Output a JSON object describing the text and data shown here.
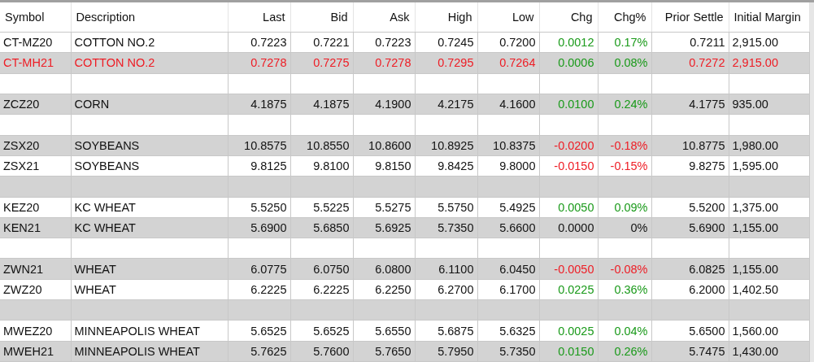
{
  "table": {
    "columns": [
      "Symbol",
      "Description",
      "Last",
      "Bid",
      "Ask",
      "High",
      "Low",
      "Chg",
      "Chg%",
      "Prior Settle",
      "Initial Margin"
    ],
    "rows": [
      {
        "kind": "quote",
        "alert": false,
        "color": "#1a9a1a",
        "cells": [
          "CT-MZ20",
          "COTTON NO.2",
          "0.7223",
          "0.7221",
          "0.7223",
          "0.7245",
          "0.7200",
          "0.0012",
          "0.17%",
          "0.7211",
          "2,915.00"
        ]
      },
      {
        "kind": "quote",
        "alert": true,
        "color": "#1a9a1a",
        "cells": [
          "CT-MH21",
          "COTTON NO.2",
          "0.7278",
          "0.7275",
          "0.7278",
          "0.7295",
          "0.7264",
          "0.0006",
          "0.08%",
          "0.7272",
          "2,915.00"
        ]
      },
      {
        "kind": "blank"
      },
      {
        "kind": "quote",
        "alert": false,
        "color": "#1a9a1a",
        "cells": [
          "ZCZ20",
          "CORN",
          "4.1875",
          "4.1875",
          "4.1900",
          "4.2175",
          "4.1600",
          "0.0100",
          "0.24%",
          "4.1775",
          "935.00"
        ]
      },
      {
        "kind": "blank"
      },
      {
        "kind": "quote",
        "alert": false,
        "color": "#ee1c24",
        "cells": [
          "ZSX20",
          "SOYBEANS",
          "10.8575",
          "10.8550",
          "10.8600",
          "10.8925",
          "10.8375",
          "-0.0200",
          "-0.18%",
          "10.8775",
          "1,980.00"
        ]
      },
      {
        "kind": "quote",
        "alert": false,
        "color": "#ee1c24",
        "cells": [
          "ZSX21",
          "SOYBEANS",
          "9.8125",
          "9.8100",
          "9.8150",
          "9.8425",
          "9.8000",
          "-0.0150",
          "-0.15%",
          "9.8275",
          "1,595.00"
        ]
      },
      {
        "kind": "blank"
      },
      {
        "kind": "quote",
        "alert": false,
        "color": "#1a9a1a",
        "cells": [
          "KEZ20",
          "KC WHEAT",
          "5.5250",
          "5.5225",
          "5.5275",
          "5.5750",
          "5.4925",
          "0.0050",
          "0.09%",
          "5.5200",
          "1,375.00"
        ]
      },
      {
        "kind": "quote",
        "alert": false,
        "color": "#111111",
        "cells": [
          "KEN21",
          "KC WHEAT",
          "5.6900",
          "5.6850",
          "5.6925",
          "5.7350",
          "5.6600",
          "0.0000",
          "0%",
          "5.6900",
          "1,155.00"
        ]
      },
      {
        "kind": "blank"
      },
      {
        "kind": "quote",
        "alert": false,
        "color": "#ee1c24",
        "cells": [
          "ZWN21",
          "WHEAT",
          "6.0775",
          "6.0750",
          "6.0800",
          "6.1100",
          "6.0450",
          "-0.0050",
          "-0.08%",
          "6.0825",
          "1,155.00"
        ]
      },
      {
        "kind": "quote",
        "alert": false,
        "color": "#1a9a1a",
        "cells": [
          "ZWZ20",
          "WHEAT",
          "6.2225",
          "6.2225",
          "6.2250",
          "6.2700",
          "6.1700",
          "0.0225",
          "0.36%",
          "6.2000",
          "1,402.50"
        ]
      },
      {
        "kind": "blank"
      },
      {
        "kind": "quote",
        "alert": false,
        "color": "#1a9a1a",
        "cells": [
          "MWEZ20",
          "MINNEAPOLIS WHEAT",
          "5.6525",
          "5.6525",
          "5.6550",
          "5.6875",
          "5.6325",
          "0.0025",
          "0.04%",
          "5.6500",
          "1,560.00"
        ]
      },
      {
        "kind": "quote",
        "alert": false,
        "color": "#1a9a1a",
        "cells": [
          "MWEH21",
          "MINNEAPOLIS WHEAT",
          "5.7625",
          "5.7600",
          "5.7650",
          "5.7950",
          "5.7350",
          "0.0150",
          "0.26%",
          "5.7475",
          "1,430.00"
        ]
      }
    ]
  }
}
